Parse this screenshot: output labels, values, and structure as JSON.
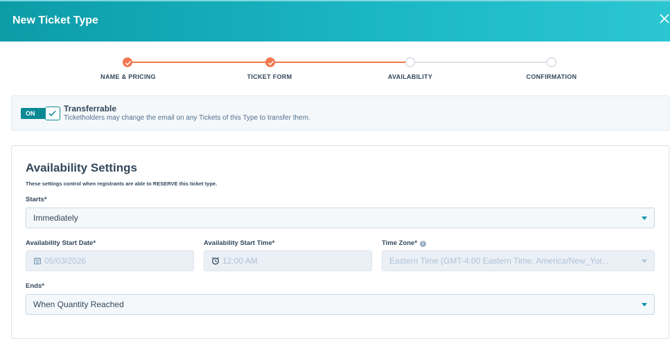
{
  "header": {
    "title": "New Ticket Type",
    "close_icon": "close-icon"
  },
  "stepper": {
    "steps": [
      {
        "label": "NAME & PRICING",
        "status": "done"
      },
      {
        "label": "TICKET FORM",
        "status": "done"
      },
      {
        "label": "AVAILABILITY",
        "status": "current"
      },
      {
        "label": "CONFIRMATION",
        "status": "todo"
      }
    ],
    "colors": {
      "done": "#f2784f",
      "todo": "#c5ced8"
    }
  },
  "transferrable": {
    "toggle_label": "ON",
    "enabled": true,
    "title": "Transferrable",
    "description": "Ticketholders may change the email on any Tickets of this Type to transfer them."
  },
  "availability": {
    "title": "Availability Settings",
    "subtitle": "These settings control when registrants are able to RESERVE this ticket type.",
    "starts": {
      "label": "Starts*",
      "value": "Immediately"
    },
    "start_date": {
      "label": "Availability Start Date*",
      "value": "05/03/2026",
      "icon": "calendar-icon"
    },
    "start_time": {
      "label": "Availability Start Time*",
      "value": "12:00 AM",
      "icon": "clock-icon"
    },
    "time_zone": {
      "label": "Time Zone*",
      "value": "Eastern Time (GMT-4:00 Eastern Time; America/New_Yor...",
      "icon": "info-icon"
    },
    "ends": {
      "label": "Ends*",
      "value": "When Quantity Reached"
    }
  }
}
